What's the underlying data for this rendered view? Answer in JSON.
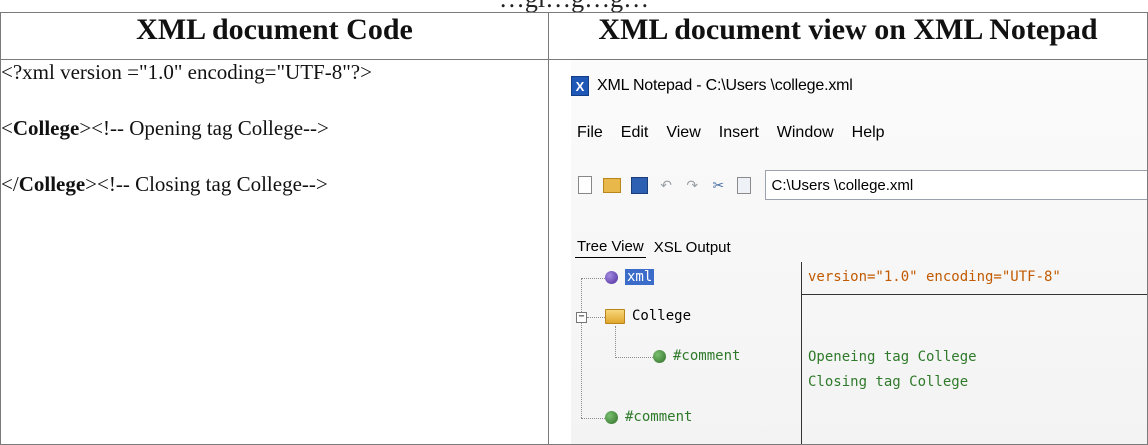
{
  "caption": "…gi…g…g…",
  "table": {
    "headers": [
      "XML document Code",
      "XML document view on XML Notepad"
    ],
    "code_lines": [
      {
        "pre": "<?xml version =\"1.0\" encoding=\"UTF-8\"?>",
        "bold": "",
        "post": ""
      },
      {
        "pre": "<",
        "bold": "College",
        "post": "><!-- Opening tag College-->"
      },
      {
        "pre": "</",
        "bold": "College",
        "post": "><!-- Closing tag College-->"
      }
    ]
  },
  "notepad": {
    "window_title": "XML Notepad - C:\\Users \\college.xml",
    "app_icon_letter": "X",
    "menu": [
      "File",
      "Edit",
      "View",
      "Insert",
      "Window",
      "Help"
    ],
    "toolbar_icons": [
      "new-file-icon",
      "open-folder-icon",
      "save-icon",
      "undo-icon",
      "redo-icon",
      "cut-icon",
      "copy-icon"
    ],
    "path_value": "C:\\Users \\college.xml",
    "tabs": [
      "Tree View",
      "XSL Output"
    ],
    "tree": {
      "nodes": [
        "xml",
        "College",
        "#comment",
        "#comment"
      ]
    },
    "values": [
      "version=\"1.0\" encoding=\"UTF-8\"",
      "Openeing tag College",
      "Closing tag College"
    ]
  }
}
